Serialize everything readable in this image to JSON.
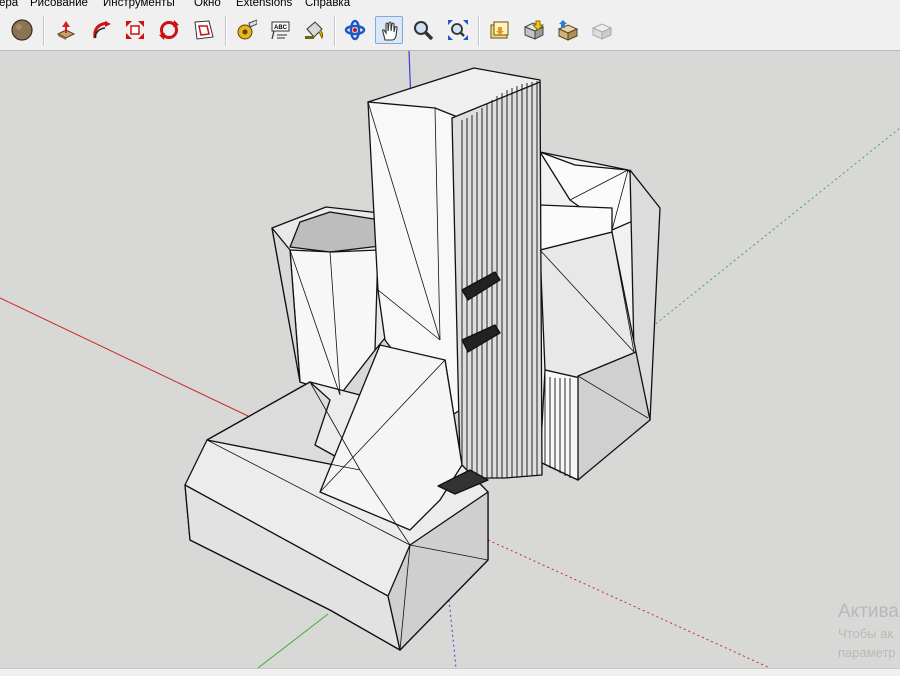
{
  "menu": {
    "items": [
      {
        "id": "camera",
        "label": "ера"
      },
      {
        "id": "draw",
        "label": "Рисование"
      },
      {
        "id": "tools",
        "label": "Инструменты"
      },
      {
        "id": "window",
        "label": "Окно"
      },
      {
        "id": "extensions",
        "label": "Extensions"
      },
      {
        "id": "help",
        "label": "Справка"
      }
    ]
  },
  "toolbar": {
    "active_tool": "pan-hand",
    "tools": [
      "paint-ball-icon",
      "push-pull-icon",
      "follow-me-icon",
      "scale-icon",
      "rotate-icon",
      "offset-icon",
      "tape-measure-icon",
      "text-icon",
      "paint-bucket-icon",
      "orbit-icon",
      "pan-hand-icon",
      "zoom-icon",
      "zoom-extents-icon",
      "get-models-icon",
      "share-model-icon",
      "extension-warehouse-icon",
      "share-component-icon"
    ]
  },
  "colors": {
    "viewport_bg": "#d8d8d6",
    "axis_red": "#cc2a2a",
    "axis_green": "#3fae3f",
    "axis_blue": "#3c3cd8"
  },
  "watermark": {
    "title": "Актива",
    "line1": "Чтобы ак",
    "line2": "параметр"
  }
}
